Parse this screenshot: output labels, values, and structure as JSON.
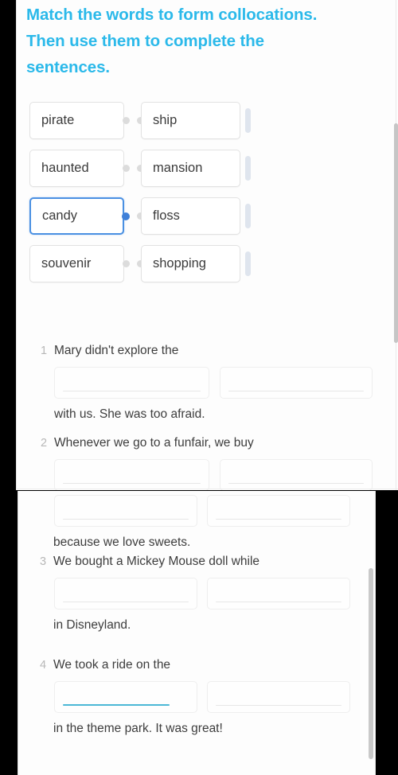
{
  "heading": {
    "text": "Match the words to form collocations. Then use them to complete the sentences."
  },
  "colors": {
    "heading": "#2bb9ea",
    "selected_border": "#4a90e2",
    "active_underline": "#4cb8d6",
    "blank_underline": "#e7e7e7",
    "number": "#b7b7b7",
    "body_text": "#3d3d3d"
  },
  "matching": {
    "pairs": [
      {
        "left": "pirate",
        "right": "ship",
        "selected": false
      },
      {
        "left": "haunted",
        "right": "mansion",
        "selected": false
      },
      {
        "left": "candy",
        "right": "floss",
        "selected": true
      },
      {
        "left": "souvenir",
        "right": "shopping",
        "selected": false
      }
    ]
  },
  "questions": [
    {
      "number": "1",
      "text_before": "Mary didn't explore the",
      "text_after": "with us. She was too afraid.",
      "blank_1": "",
      "blank_2": "",
      "blank_1_filled": false
    },
    {
      "number": "2",
      "text_before": "Whenever we go to a funfair, we buy",
      "text_after": "because we love sweets.",
      "blank_1": "",
      "blank_2": "",
      "blank_1_filled": false
    },
    {
      "number": "3",
      "text_before": "We bought a Mickey Mouse doll while",
      "text_after": "in Disneyland.",
      "blank_1": "",
      "blank_2": "",
      "blank_1_filled": false
    },
    {
      "number": "4",
      "text_before": "We took a ride on the",
      "text_after": "in the theme park. It was great!",
      "blank_1": "",
      "blank_2": "",
      "blank_1_filled": true
    }
  ]
}
